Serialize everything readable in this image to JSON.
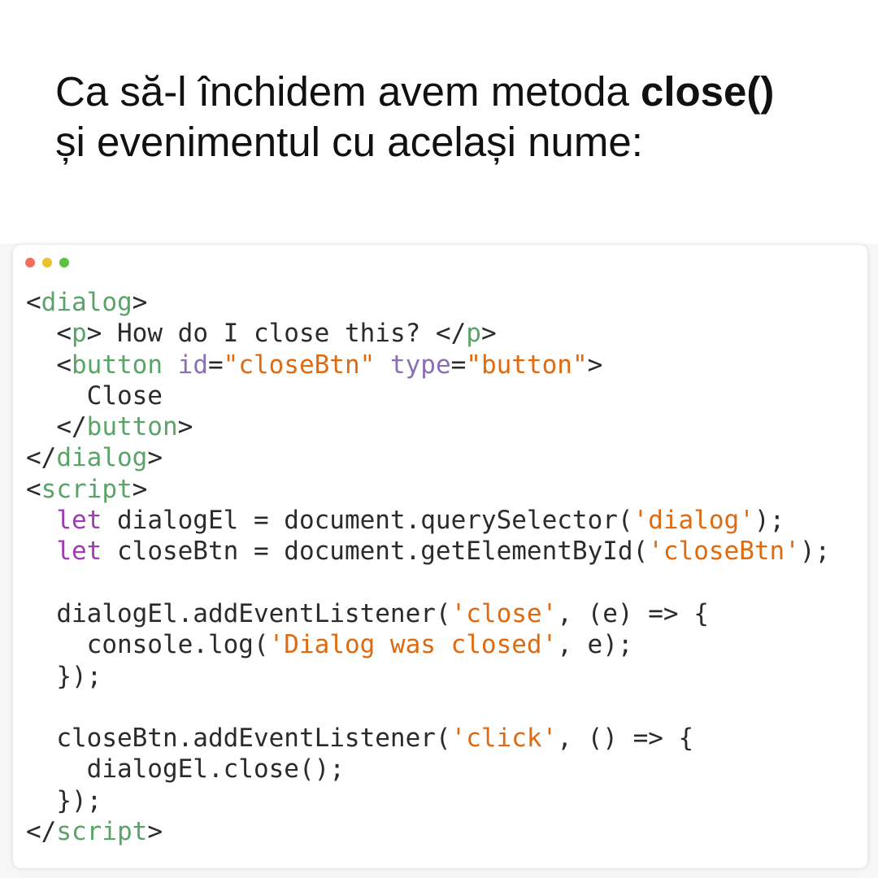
{
  "heading": {
    "line1_prefix": "Ca să-l închidem avem metoda ",
    "line1_bold": "close()",
    "line2": "și evenimentul cu același nume:"
  },
  "window": {
    "dots": [
      {
        "name": "close-dot",
        "color": "#f26d5f"
      },
      {
        "name": "minimize-dot",
        "color": "#e9c22e"
      },
      {
        "name": "maximize-dot",
        "color": "#5cc43b"
      }
    ]
  },
  "colors": {
    "tag": "#5aa469",
    "attribute": "#8a6fb5",
    "string": "#e06a10",
    "keyword": "#a03bb4",
    "text": "#2b2b2b"
  },
  "code": {
    "lines": [
      [
        {
          "t": "<",
          "c": ""
        },
        {
          "t": "dialog",
          "c": "tag"
        },
        {
          "t": ">",
          "c": ""
        }
      ],
      [
        {
          "t": "  <",
          "c": ""
        },
        {
          "t": "p",
          "c": "tag"
        },
        {
          "t": "> How do I close this? </",
          "c": ""
        },
        {
          "t": "p",
          "c": "tag"
        },
        {
          "t": ">",
          "c": ""
        }
      ],
      [
        {
          "t": "  <",
          "c": ""
        },
        {
          "t": "button",
          "c": "tag"
        },
        {
          "t": " ",
          "c": ""
        },
        {
          "t": "id",
          "c": "attr"
        },
        {
          "t": "=",
          "c": ""
        },
        {
          "t": "\"closeBtn\"",
          "c": "str"
        },
        {
          "t": " ",
          "c": ""
        },
        {
          "t": "type",
          "c": "attr"
        },
        {
          "t": "=",
          "c": ""
        },
        {
          "t": "\"button\"",
          "c": "str"
        },
        {
          "t": ">",
          "c": ""
        }
      ],
      [
        {
          "t": "    Close",
          "c": ""
        }
      ],
      [
        {
          "t": "  </",
          "c": ""
        },
        {
          "t": "button",
          "c": "tag"
        },
        {
          "t": ">",
          "c": ""
        }
      ],
      [
        {
          "t": "</",
          "c": ""
        },
        {
          "t": "dialog",
          "c": "tag"
        },
        {
          "t": ">",
          "c": ""
        }
      ],
      [
        {
          "t": "<",
          "c": ""
        },
        {
          "t": "script",
          "c": "tag"
        },
        {
          "t": ">",
          "c": ""
        }
      ],
      [
        {
          "t": "  ",
          "c": ""
        },
        {
          "t": "let",
          "c": "kw"
        },
        {
          "t": " dialogEl = document.querySelector(",
          "c": ""
        },
        {
          "t": "'dialog'",
          "c": "str"
        },
        {
          "t": ");",
          "c": ""
        }
      ],
      [
        {
          "t": "  ",
          "c": ""
        },
        {
          "t": "let",
          "c": "kw"
        },
        {
          "t": " closeBtn = document.getElementById(",
          "c": ""
        },
        {
          "t": "'closeBtn'",
          "c": "str"
        },
        {
          "t": ");",
          "c": ""
        }
      ],
      [],
      [
        {
          "t": "  dialogEl.addEventListener(",
          "c": ""
        },
        {
          "t": "'close'",
          "c": "str"
        },
        {
          "t": ", (e) => {",
          "c": ""
        }
      ],
      [
        {
          "t": "    console.log(",
          "c": ""
        },
        {
          "t": "'Dialog was closed'",
          "c": "str"
        },
        {
          "t": ", e);",
          "c": ""
        }
      ],
      [
        {
          "t": "  });",
          "c": ""
        }
      ],
      [],
      [
        {
          "t": "  closeBtn.addEventListener(",
          "c": ""
        },
        {
          "t": "'click'",
          "c": "str"
        },
        {
          "t": ", () => {",
          "c": ""
        }
      ],
      [
        {
          "t": "    dialogEl.close();",
          "c": ""
        }
      ],
      [
        {
          "t": "  });",
          "c": ""
        }
      ],
      [
        {
          "t": "</",
          "c": ""
        },
        {
          "t": "script",
          "c": "tag"
        },
        {
          "t": ">",
          "c": ""
        }
      ]
    ]
  }
}
